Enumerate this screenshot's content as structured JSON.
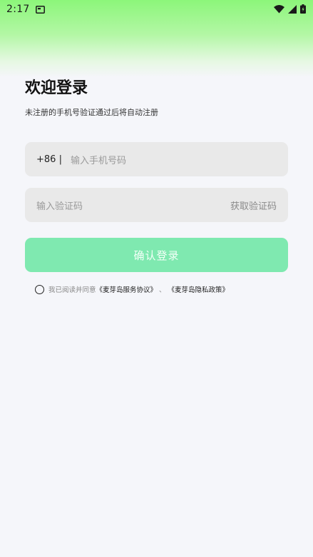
{
  "status_bar": {
    "time": "2:17"
  },
  "login": {
    "title": "欢迎登录",
    "subtitle": "未注册的手机号验证通过后将自动注册",
    "phone": {
      "prefix": "+86 |",
      "placeholder": "输入手机号码"
    },
    "code": {
      "placeholder": "输入验证码",
      "get_code_label": "获取验证码"
    },
    "confirm_label": "确认登录",
    "agreement": {
      "text": "我已阅读并同意",
      "service_link": "《麦芽岛服务协议》",
      "separator": "、",
      "privacy_link": "《麦芽岛隐私政策》",
      "checked": false
    }
  },
  "colors": {
    "accent": "#7fe9b0",
    "background": "#f5f6fa",
    "field": "#e9e9e9",
    "gradient_top": "#8cf67a"
  }
}
